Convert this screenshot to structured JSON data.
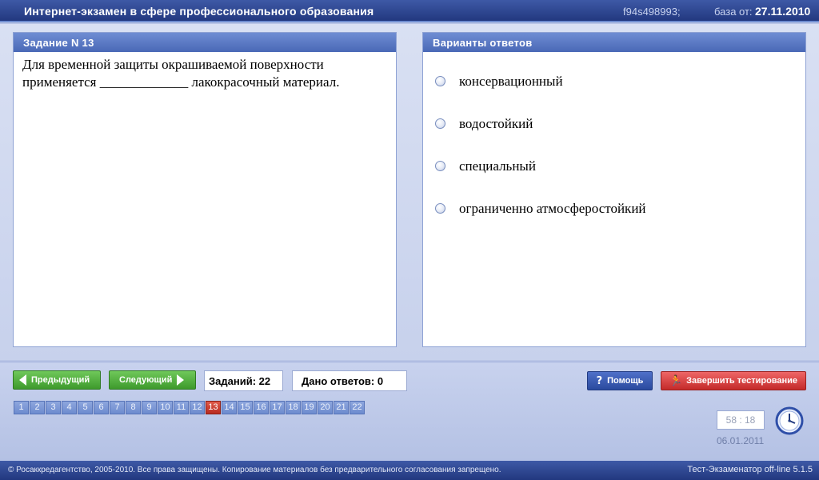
{
  "header": {
    "title": "Интернет-экзамен в сфере профессионального образования",
    "code": "f94s498993;",
    "base_label": "база от:",
    "base_date": "27.11.2010"
  },
  "task": {
    "header": "Задание N 13",
    "question": "Для временной защиты окрашиваемой поверхности применяется _____________ лакокрасочный материал."
  },
  "answers": {
    "header": "Варианты ответов",
    "options": [
      "консервационный",
      "водостойкий",
      "специальный",
      "ограниченно атмосферостойкий"
    ]
  },
  "controls": {
    "prev_label": "Предыдущий",
    "next_label": "Следующий",
    "tasks_count": "Заданий: 22",
    "answered_count": "Дано ответов: 0",
    "help_label": "Помощь",
    "finish_label": "Завершить тестирование"
  },
  "pager": {
    "pages": [
      "1",
      "2",
      "3",
      "4",
      "5",
      "6",
      "7",
      "8",
      "9",
      "10",
      "11",
      "12",
      "13",
      "14",
      "15",
      "16",
      "17",
      "18",
      "19",
      "20",
      "21",
      "22"
    ],
    "current": "13"
  },
  "timer": {
    "time": "58 : 18",
    "date": "06.01.2011"
  },
  "footer": {
    "copyright": "© Росаккредагентство, 2005-2010. Все права защищены. Копирование материалов без предварительного согласования запрещено.",
    "version": "Тест-Экзаменатор off-line 5.1.5"
  },
  "colors": {
    "header_bg": "#22387f",
    "panel_header": "#4968b6",
    "current_page": "#b82a20",
    "finish_button": "#c42a2a",
    "nav_button": "#3e9a2c"
  }
}
